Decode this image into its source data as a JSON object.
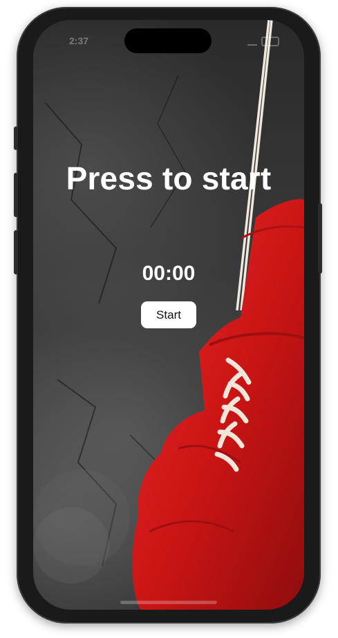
{
  "status_bar": {
    "time": "2:37",
    "signal_icon": "signal-icon",
    "battery_icon": "battery-icon"
  },
  "main": {
    "title": "Press to start",
    "timer": "00:00",
    "start_label": "Start"
  },
  "colors": {
    "button_bg": "#ffffff",
    "text": "#ffffff",
    "glove_red": "#d11f1f",
    "background_dark": "#2f2f2f"
  }
}
